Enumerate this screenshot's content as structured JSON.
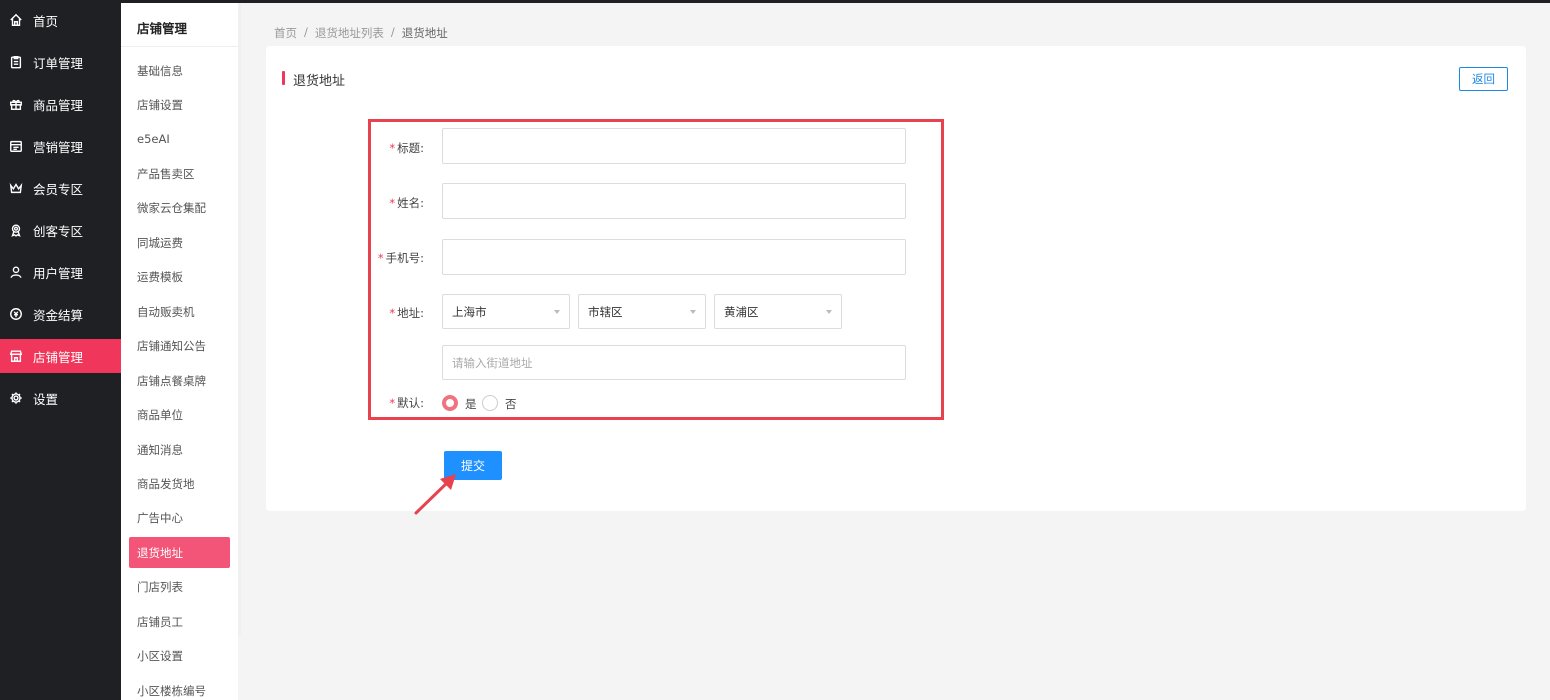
{
  "main_nav": [
    {
      "label": "首页",
      "icon": "home-icon"
    },
    {
      "label": "订单管理",
      "icon": "clipboard-icon"
    },
    {
      "label": "商品管理",
      "icon": "gift-icon"
    },
    {
      "label": "营销管理",
      "icon": "calendar-icon"
    },
    {
      "label": "会员专区",
      "icon": "crown-icon"
    },
    {
      "label": "创客专区",
      "icon": "award-icon"
    },
    {
      "label": "用户管理",
      "icon": "user-icon"
    },
    {
      "label": "资金结算",
      "icon": "money-icon"
    },
    {
      "label": "店铺管理",
      "icon": "store-icon",
      "active": true
    },
    {
      "label": "设置",
      "icon": "gear-icon"
    }
  ],
  "sub_nav": {
    "title": "店铺管理",
    "items": [
      "基础信息",
      "店铺设置",
      "e5eAI",
      "产品售卖区",
      "微家云仓集配",
      "同城运费",
      "运费模板",
      "自动贩卖机",
      "店铺通知公告",
      "店铺点餐桌牌",
      "商品单位",
      "通知消息",
      "商品发货地",
      "广告中心",
      "退货地址",
      "门店列表",
      "店铺员工",
      "小区设置",
      "小区楼栋编号"
    ],
    "active_index": 14
  },
  "breadcrumb": {
    "items": [
      "首页",
      "退货地址列表",
      "退货地址"
    ],
    "separator": "/"
  },
  "card": {
    "title": "退货地址",
    "back_label": "返回"
  },
  "form": {
    "required_mark": "*",
    "title_label": "标题:",
    "title_value": "",
    "name_label": "姓名:",
    "name_value": "",
    "phone_label": "手机号:",
    "phone_value": "",
    "address_label": "地址:",
    "province": "上海市",
    "city": "市辖区",
    "district": "黄浦区",
    "street_placeholder": "请输入街道地址",
    "default_label": "默认:",
    "yes_label": "是",
    "no_label": "否",
    "default_selected": "是",
    "submit_label": "提交"
  },
  "colors": {
    "accent": "#f0365a",
    "primary": "#1e90ff",
    "highlight_box": "#e8424f"
  }
}
